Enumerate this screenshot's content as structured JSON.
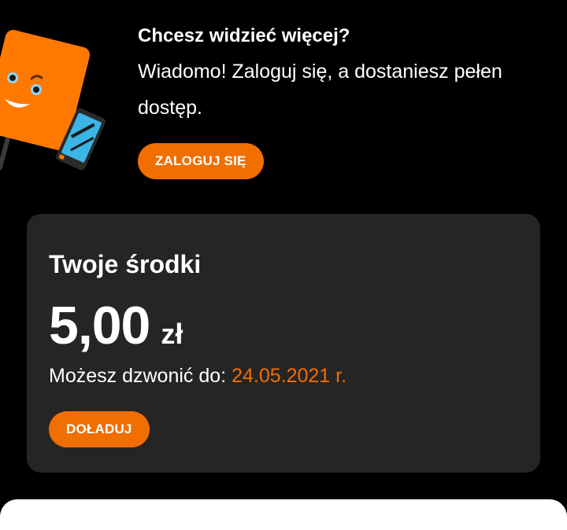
{
  "promo": {
    "title": "Chcesz widzieć więcej?",
    "body": "Wiadomo! Zaloguj się, a dostaniesz pełen dostęp.",
    "login_button": "ZALOGUJ SIĘ",
    "mascot_icon": "orange-mascot-with-phone-icon"
  },
  "balance": {
    "title": "Twoje środki",
    "amount": "5,00",
    "currency": "zł",
    "valid_label": "Możesz dzwonić do:",
    "valid_date": "24.05.2021 r.",
    "topup_button": "DOŁADUJ"
  },
  "colors": {
    "accent": "#f16e00",
    "background": "#000000",
    "card": "#252525",
    "text": "#ffffff"
  }
}
